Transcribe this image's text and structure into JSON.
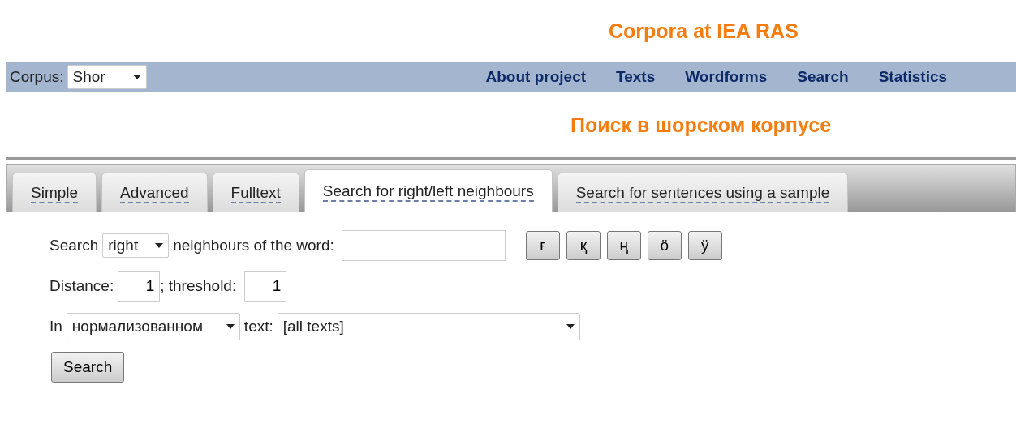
{
  "site_title": "Corpora at IEA RAS",
  "nav": {
    "corpus_label": "Corpus:",
    "corpus_value": "Shor",
    "links": [
      "About project",
      "Texts",
      "Wordforms",
      "Search",
      "Statistics"
    ]
  },
  "page_title": "Поиск в шорском корпусе",
  "tabs": [
    {
      "label": "Simple",
      "selected": false
    },
    {
      "label": "Advanced",
      "selected": false
    },
    {
      "label": "Fulltext",
      "selected": false
    },
    {
      "label": "Search for right/left neighbours",
      "selected": true
    },
    {
      "label": "Search for sentences using a sample",
      "selected": false
    }
  ],
  "form": {
    "search_label": "Search",
    "direction": "right",
    "neighbours_label": "neighbours of the word:",
    "letters": [
      "ғ",
      "қ",
      "ң",
      "ö",
      "ÿ"
    ],
    "distance_label": "Distance:",
    "distance": "1",
    "threshold_label": "; threshold:",
    "threshold": "1",
    "in_label": "In",
    "text_kind": "нормализованном",
    "text_label": "text:",
    "texts": "[all texts]",
    "submit": "Search"
  }
}
